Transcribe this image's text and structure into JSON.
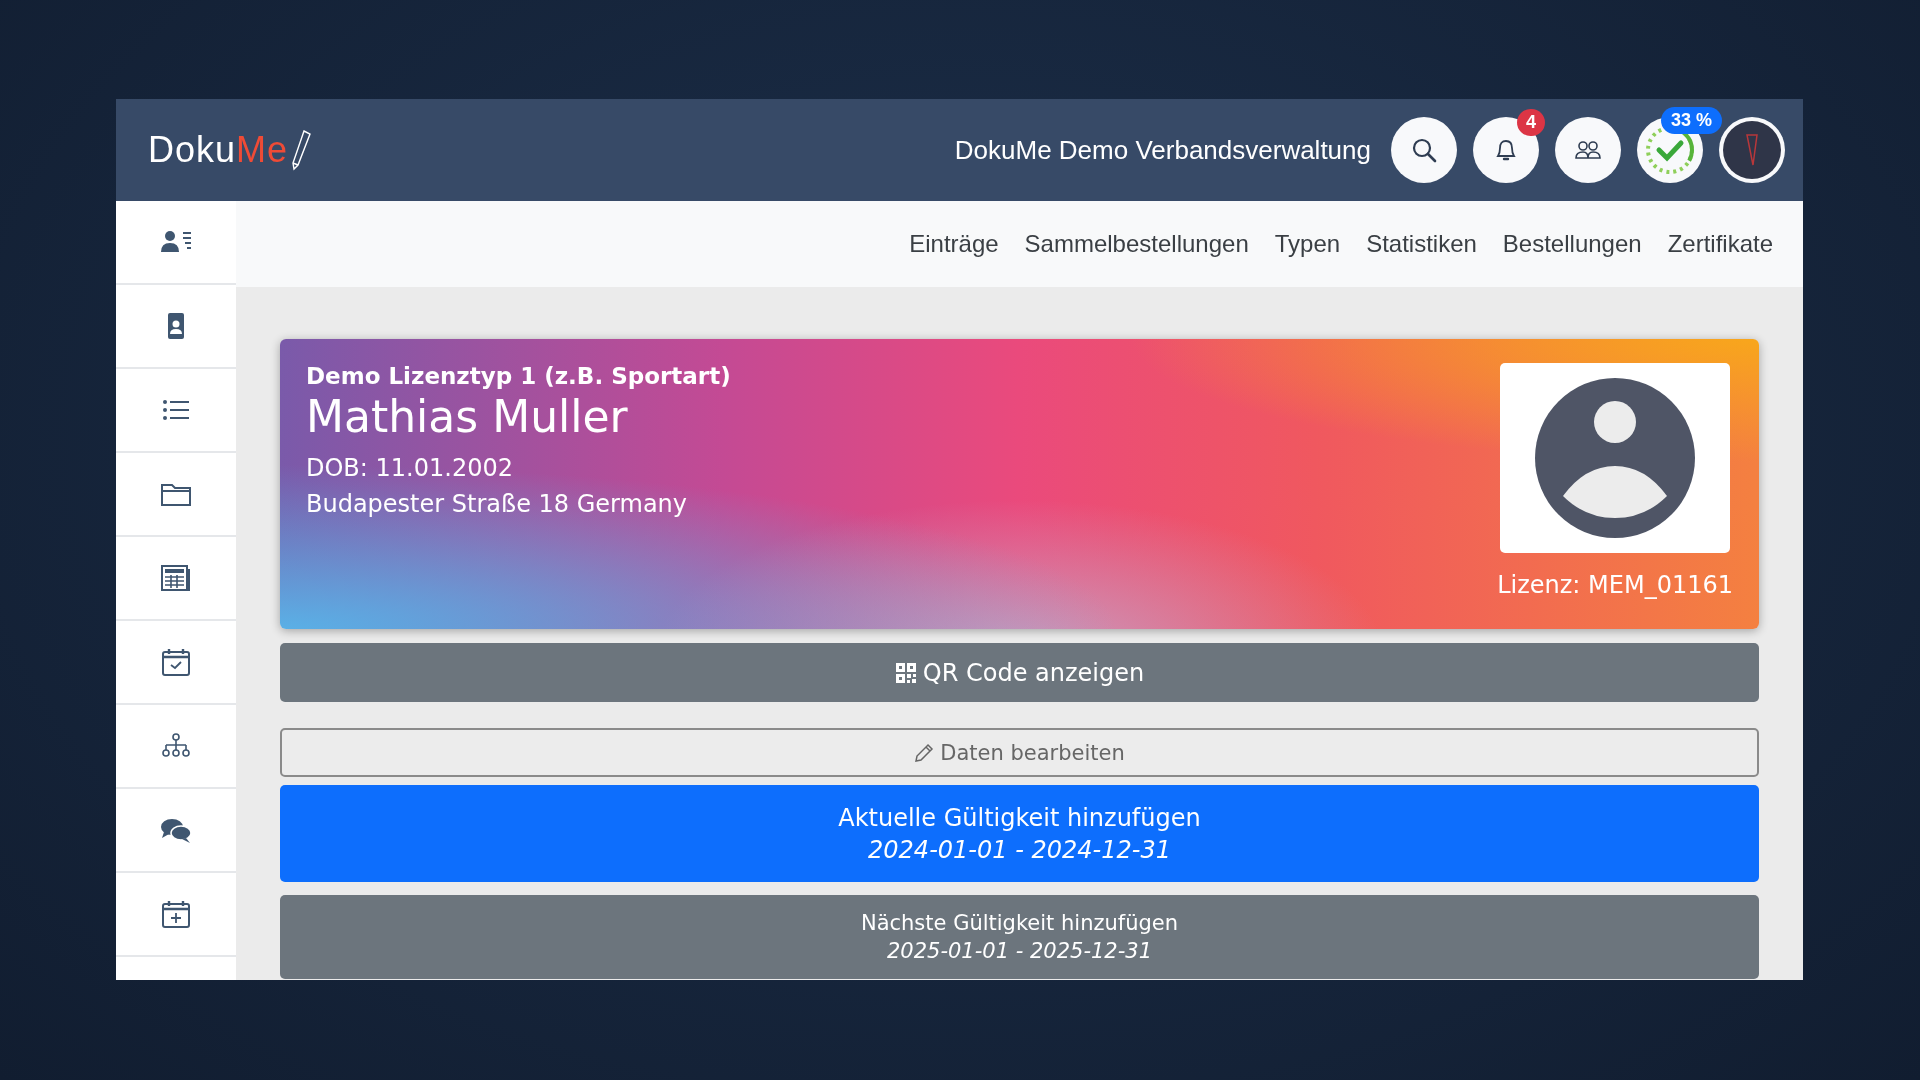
{
  "header": {
    "logo": {
      "part_1": "Doku",
      "part_2": "Me"
    },
    "title": "DokuMe Demo Verbandsverwaltung",
    "notifications": {
      "count": "4"
    },
    "progress": {
      "label": "33 %",
      "level": 0.33
    }
  },
  "nav": [
    "Einträge",
    "Sammelbestellungen",
    "Typen",
    "Statistiken",
    "Bestellungen",
    "Zertifikate"
  ],
  "member_card": {
    "license_type": "Demo Lizenztyp 1 (z.B. Sportart)",
    "name": "Mathias Muller",
    "dob": "DOB: 11.01.2002",
    "address": "Budapester Straße 18 Germany",
    "license": "Lizenz: MEM_01161"
  },
  "actions": [
    {
      "kind": "qr",
      "label": "QR Code anzeigen"
    },
    {
      "kind": "edit",
      "label": "Daten bearbeiten"
    },
    {
      "kind": "current",
      "label": "Aktuelle Gültigkeit hinzufügen",
      "period": "2024-01-01 - 2024-12-31"
    },
    {
      "kind": "next",
      "label": "Nächste Gültigkeit hinzufügen",
      "period": "2025-01-01 - 2025-12-31"
    }
  ]
}
